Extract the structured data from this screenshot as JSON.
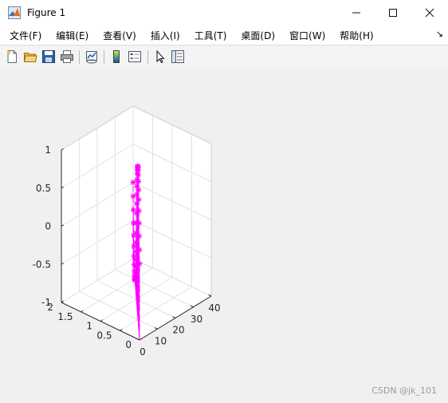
{
  "window": {
    "title": "Figure 1",
    "minimize_glyph": "—",
    "maximize_glyph": "☐",
    "close_glyph": "✕"
  },
  "menu": {
    "items": [
      "文件(F)",
      "编辑(E)",
      "查看(V)",
      "插入(I)",
      "工具(T)",
      "桌面(D)",
      "窗口(W)",
      "帮助(H)"
    ],
    "overflow_glyph": "↘"
  },
  "toolbar": {
    "icons": [
      "new-figure-icon",
      "open-file-icon",
      "save-icon",
      "print-icon",
      "link-plot-icon",
      "insert-colorbar-icon",
      "insert-legend-icon",
      "select-arrow-icon",
      "property-inspector-icon"
    ]
  },
  "chart_data": {
    "type": "scatter3d-stem",
    "marker": "*",
    "color": "#ff00ff",
    "x": [
      0,
      40
    ],
    "y": [
      0,
      2
    ],
    "z": [
      -1,
      1
    ],
    "xlim": [
      0,
      40
    ],
    "ylim": [
      0,
      2
    ],
    "zlim": [
      -1,
      1
    ],
    "xticks": [
      "0",
      "10",
      "20",
      "30",
      "40"
    ],
    "yticks": [
      "0",
      "0.5",
      "1",
      "1.5",
      "2"
    ],
    "zticks": [
      "-1",
      "-0.5",
      "0",
      "0.5",
      "1"
    ],
    "grid": true,
    "series": [
      {
        "x": [
          0,
          1,
          2,
          3,
          4,
          5,
          6,
          7,
          8,
          9,
          10,
          11,
          12,
          13,
          14,
          15,
          16,
          17,
          18,
          19,
          20,
          21,
          22,
          23,
          24,
          25,
          26,
          27,
          28,
          29,
          30,
          31,
          32,
          33,
          34,
          35,
          36,
          37,
          38,
          39,
          40
        ],
        "y": [
          0,
          0.05,
          0.1,
          0.15,
          0.2,
          0.25,
          0.3,
          0.35,
          0.4,
          0.45,
          0.5,
          0.55,
          0.6,
          0.65,
          0.7,
          0.75,
          0.8,
          0.85,
          0.9,
          0.95,
          1,
          1.05,
          1.1,
          1.15,
          1.2,
          1.25,
          1.3,
          1.35,
          1.4,
          1.45,
          1.5,
          1.55,
          1.6,
          1.65,
          1.7,
          1.75,
          1.8,
          1.85,
          1.9,
          1.95,
          2
        ],
        "z": [
          0,
          0.156,
          0.309,
          0.454,
          0.588,
          0.707,
          0.809,
          0.891,
          0.951,
          0.988,
          1,
          0.988,
          0.951,
          0.891,
          0.809,
          0.707,
          0.588,
          0.454,
          0.309,
          0.156,
          0,
          -0.156,
          -0.309,
          -0.454,
          -0.588,
          -0.707,
          -0.809,
          -0.891,
          -0.951,
          -0.988,
          -1,
          -0.988,
          -0.951,
          -0.891,
          -0.809,
          -0.707,
          -0.588,
          -0.454,
          -0.309,
          -0.156,
          0
        ]
      }
    ]
  },
  "watermark": "CSDN @jk_101"
}
